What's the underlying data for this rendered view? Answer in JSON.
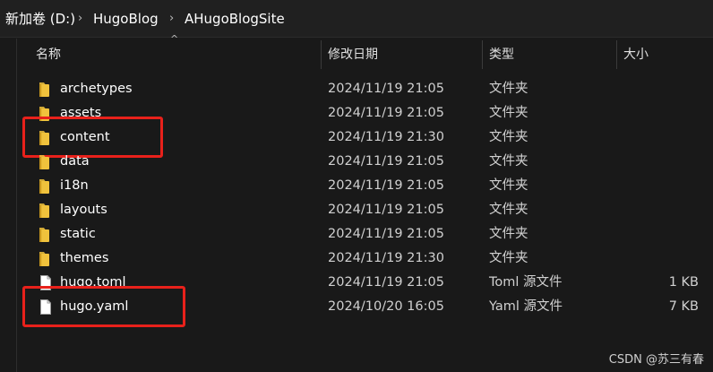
{
  "breadcrumb": {
    "items": [
      "新加卷 (D:)",
      "HugoBlog",
      "AHugoBlogSite"
    ],
    "separator": "›"
  },
  "columns": {
    "name": "名称",
    "date": "修改日期",
    "type": "类型",
    "size": "大小"
  },
  "files": [
    {
      "name": "archetypes",
      "date": "2024/11/19 21:05",
      "type": "文件夹",
      "size": "",
      "kind": "folder",
      "highlighted": false
    },
    {
      "name": "assets",
      "date": "2024/11/19 21:05",
      "type": "文件夹",
      "size": "",
      "kind": "folder",
      "highlighted": false
    },
    {
      "name": "content",
      "date": "2024/11/19 21:30",
      "type": "文件夹",
      "size": "",
      "kind": "folder",
      "highlighted": true
    },
    {
      "name": "data",
      "date": "2024/11/19 21:05",
      "type": "文件夹",
      "size": "",
      "kind": "folder",
      "highlighted": false
    },
    {
      "name": "i18n",
      "date": "2024/11/19 21:05",
      "type": "文件夹",
      "size": "",
      "kind": "folder",
      "highlighted": false
    },
    {
      "name": "layouts",
      "date": "2024/11/19 21:05",
      "type": "文件夹",
      "size": "",
      "kind": "folder",
      "highlighted": false
    },
    {
      "name": "static",
      "date": "2024/11/19 21:05",
      "type": "文件夹",
      "size": "",
      "kind": "folder",
      "highlighted": false
    },
    {
      "name": "themes",
      "date": "2024/11/19 21:30",
      "type": "文件夹",
      "size": "",
      "kind": "folder",
      "highlighted": false
    },
    {
      "name": "hugo.toml",
      "date": "2024/11/19 21:05",
      "type": "Toml 源文件",
      "size": "1 KB",
      "kind": "file",
      "highlighted": false
    },
    {
      "name": "hugo.yaml",
      "date": "2024/10/20 16:05",
      "type": "Yaml 源文件",
      "size": "7 KB",
      "kind": "file",
      "highlighted": true
    }
  ],
  "watermark": "CSDN @苏三有春",
  "colors": {
    "background": "#191919",
    "folder": "#f0c23c",
    "highlight": "#e8211b"
  },
  "icons": {
    "folder": "folder-icon",
    "file": "file-icon",
    "sort": "sort-up-icon"
  }
}
